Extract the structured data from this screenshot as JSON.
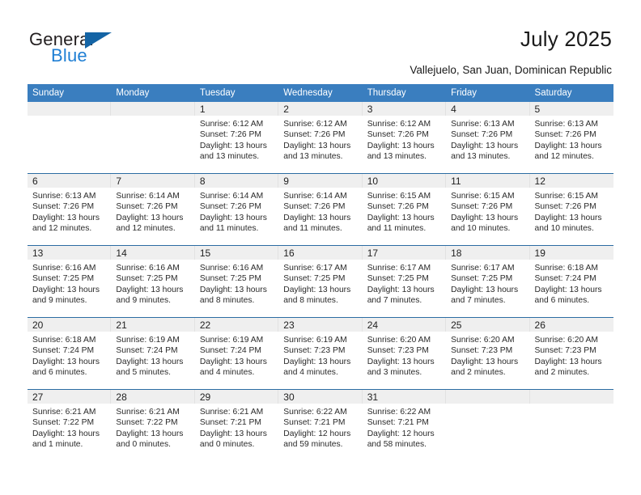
{
  "brand": {
    "line1": "General",
    "line2": "Blue",
    "flag_icon": "triangle-flag-icon",
    "colors": {
      "general": "#231f20",
      "blue": "#1f7fd4",
      "flag": "#1464a5"
    }
  },
  "header": {
    "title": "July 2025",
    "location": "Vallejuelo, San Juan, Dominican Republic"
  },
  "colors": {
    "header_row_bg": "#3a7ebf",
    "header_row_text": "#ffffff",
    "daynum_band_bg": "#efefef",
    "week_divider": "#2b6ca3"
  },
  "weekday_headers": [
    "Sunday",
    "Monday",
    "Tuesday",
    "Wednesday",
    "Thursday",
    "Friday",
    "Saturday"
  ],
  "weeks": [
    [
      {
        "day": "",
        "empty": true
      },
      {
        "day": "",
        "empty": true
      },
      {
        "day": "1",
        "sunrise": "Sunrise: 6:12 AM",
        "sunset": "Sunset: 7:26 PM",
        "daylight_1": "Daylight: 13 hours",
        "daylight_2": "and 13 minutes."
      },
      {
        "day": "2",
        "sunrise": "Sunrise: 6:12 AM",
        "sunset": "Sunset: 7:26 PM",
        "daylight_1": "Daylight: 13 hours",
        "daylight_2": "and 13 minutes."
      },
      {
        "day": "3",
        "sunrise": "Sunrise: 6:12 AM",
        "sunset": "Sunset: 7:26 PM",
        "daylight_1": "Daylight: 13 hours",
        "daylight_2": "and 13 minutes."
      },
      {
        "day": "4",
        "sunrise": "Sunrise: 6:13 AM",
        "sunset": "Sunset: 7:26 PM",
        "daylight_1": "Daylight: 13 hours",
        "daylight_2": "and 13 minutes."
      },
      {
        "day": "5",
        "sunrise": "Sunrise: 6:13 AM",
        "sunset": "Sunset: 7:26 PM",
        "daylight_1": "Daylight: 13 hours",
        "daylight_2": "and 12 minutes."
      }
    ],
    [
      {
        "day": "6",
        "sunrise": "Sunrise: 6:13 AM",
        "sunset": "Sunset: 7:26 PM",
        "daylight_1": "Daylight: 13 hours",
        "daylight_2": "and 12 minutes."
      },
      {
        "day": "7",
        "sunrise": "Sunrise: 6:14 AM",
        "sunset": "Sunset: 7:26 PM",
        "daylight_1": "Daylight: 13 hours",
        "daylight_2": "and 12 minutes."
      },
      {
        "day": "8",
        "sunrise": "Sunrise: 6:14 AM",
        "sunset": "Sunset: 7:26 PM",
        "daylight_1": "Daylight: 13 hours",
        "daylight_2": "and 11 minutes."
      },
      {
        "day": "9",
        "sunrise": "Sunrise: 6:14 AM",
        "sunset": "Sunset: 7:26 PM",
        "daylight_1": "Daylight: 13 hours",
        "daylight_2": "and 11 minutes."
      },
      {
        "day": "10",
        "sunrise": "Sunrise: 6:15 AM",
        "sunset": "Sunset: 7:26 PM",
        "daylight_1": "Daylight: 13 hours",
        "daylight_2": "and 11 minutes."
      },
      {
        "day": "11",
        "sunrise": "Sunrise: 6:15 AM",
        "sunset": "Sunset: 7:26 PM",
        "daylight_1": "Daylight: 13 hours",
        "daylight_2": "and 10 minutes."
      },
      {
        "day": "12",
        "sunrise": "Sunrise: 6:15 AM",
        "sunset": "Sunset: 7:26 PM",
        "daylight_1": "Daylight: 13 hours",
        "daylight_2": "and 10 minutes."
      }
    ],
    [
      {
        "day": "13",
        "sunrise": "Sunrise: 6:16 AM",
        "sunset": "Sunset: 7:25 PM",
        "daylight_1": "Daylight: 13 hours",
        "daylight_2": "and 9 minutes."
      },
      {
        "day": "14",
        "sunrise": "Sunrise: 6:16 AM",
        "sunset": "Sunset: 7:25 PM",
        "daylight_1": "Daylight: 13 hours",
        "daylight_2": "and 9 minutes."
      },
      {
        "day": "15",
        "sunrise": "Sunrise: 6:16 AM",
        "sunset": "Sunset: 7:25 PM",
        "daylight_1": "Daylight: 13 hours",
        "daylight_2": "and 8 minutes."
      },
      {
        "day": "16",
        "sunrise": "Sunrise: 6:17 AM",
        "sunset": "Sunset: 7:25 PM",
        "daylight_1": "Daylight: 13 hours",
        "daylight_2": "and 8 minutes."
      },
      {
        "day": "17",
        "sunrise": "Sunrise: 6:17 AM",
        "sunset": "Sunset: 7:25 PM",
        "daylight_1": "Daylight: 13 hours",
        "daylight_2": "and 7 minutes."
      },
      {
        "day": "18",
        "sunrise": "Sunrise: 6:17 AM",
        "sunset": "Sunset: 7:25 PM",
        "daylight_1": "Daylight: 13 hours",
        "daylight_2": "and 7 minutes."
      },
      {
        "day": "19",
        "sunrise": "Sunrise: 6:18 AM",
        "sunset": "Sunset: 7:24 PM",
        "daylight_1": "Daylight: 13 hours",
        "daylight_2": "and 6 minutes."
      }
    ],
    [
      {
        "day": "20",
        "sunrise": "Sunrise: 6:18 AM",
        "sunset": "Sunset: 7:24 PM",
        "daylight_1": "Daylight: 13 hours",
        "daylight_2": "and 6 minutes."
      },
      {
        "day": "21",
        "sunrise": "Sunrise: 6:19 AM",
        "sunset": "Sunset: 7:24 PM",
        "daylight_1": "Daylight: 13 hours",
        "daylight_2": "and 5 minutes."
      },
      {
        "day": "22",
        "sunrise": "Sunrise: 6:19 AM",
        "sunset": "Sunset: 7:24 PM",
        "daylight_1": "Daylight: 13 hours",
        "daylight_2": "and 4 minutes."
      },
      {
        "day": "23",
        "sunrise": "Sunrise: 6:19 AM",
        "sunset": "Sunset: 7:23 PM",
        "daylight_1": "Daylight: 13 hours",
        "daylight_2": "and 4 minutes."
      },
      {
        "day": "24",
        "sunrise": "Sunrise: 6:20 AM",
        "sunset": "Sunset: 7:23 PM",
        "daylight_1": "Daylight: 13 hours",
        "daylight_2": "and 3 minutes."
      },
      {
        "day": "25",
        "sunrise": "Sunrise: 6:20 AM",
        "sunset": "Sunset: 7:23 PM",
        "daylight_1": "Daylight: 13 hours",
        "daylight_2": "and 2 minutes."
      },
      {
        "day": "26",
        "sunrise": "Sunrise: 6:20 AM",
        "sunset": "Sunset: 7:23 PM",
        "daylight_1": "Daylight: 13 hours",
        "daylight_2": "and 2 minutes."
      }
    ],
    [
      {
        "day": "27",
        "sunrise": "Sunrise: 6:21 AM",
        "sunset": "Sunset: 7:22 PM",
        "daylight_1": "Daylight: 13 hours",
        "daylight_2": "and 1 minute."
      },
      {
        "day": "28",
        "sunrise": "Sunrise: 6:21 AM",
        "sunset": "Sunset: 7:22 PM",
        "daylight_1": "Daylight: 13 hours",
        "daylight_2": "and 0 minutes."
      },
      {
        "day": "29",
        "sunrise": "Sunrise: 6:21 AM",
        "sunset": "Sunset: 7:21 PM",
        "daylight_1": "Daylight: 13 hours",
        "daylight_2": "and 0 minutes."
      },
      {
        "day": "30",
        "sunrise": "Sunrise: 6:22 AM",
        "sunset": "Sunset: 7:21 PM",
        "daylight_1": "Daylight: 12 hours",
        "daylight_2": "and 59 minutes."
      },
      {
        "day": "31",
        "sunrise": "Sunrise: 6:22 AM",
        "sunset": "Sunset: 7:21 PM",
        "daylight_1": "Daylight: 12 hours",
        "daylight_2": "and 58 minutes."
      },
      {
        "day": "",
        "empty": true
      },
      {
        "day": "",
        "empty": true
      }
    ]
  ]
}
